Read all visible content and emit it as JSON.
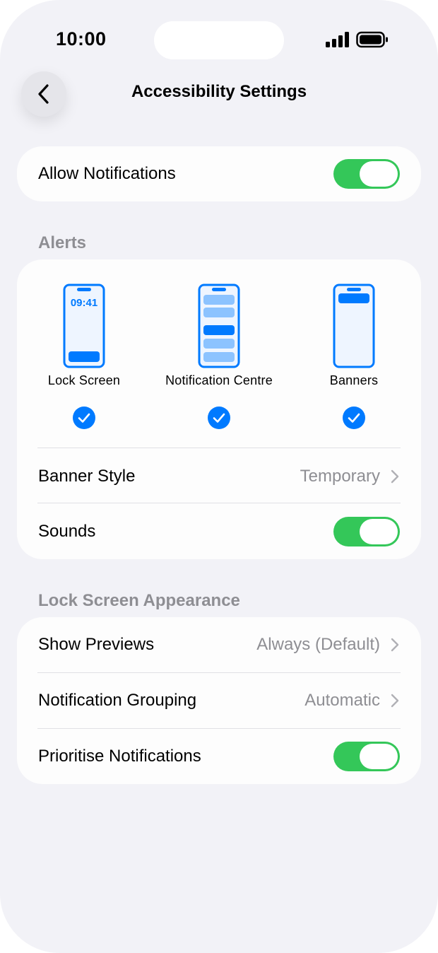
{
  "status_bar": {
    "time": "10:00"
  },
  "nav": {
    "title": "Accessibility Settings"
  },
  "allow_notifications": {
    "label": "Allow Notifications",
    "on": true
  },
  "alerts": {
    "header": "Alerts",
    "options": [
      {
        "label": "Lock Screen",
        "selected": true,
        "preview_time": "09:41"
      },
      {
        "label": "Notification Centre",
        "selected": true
      },
      {
        "label": "Banners",
        "selected": true
      }
    ],
    "banner_style": {
      "label": "Banner Style",
      "value": "Temporary"
    },
    "sounds": {
      "label": "Sounds",
      "on": true
    }
  },
  "lock_screen_appearance": {
    "header": "Lock Screen Appearance",
    "show_previews": {
      "label": "Show Previews",
      "value": "Always (Default)"
    },
    "notification_grouping": {
      "label": "Notification Grouping",
      "value": "Automatic"
    },
    "prioritise_notifications": {
      "label": "Prioritise Notifications",
      "on": true
    }
  },
  "colors": {
    "accent": "#007aff",
    "toggle_on": "#34c759",
    "background": "#f2f2f7",
    "secondary_text": "#8e8e93"
  }
}
